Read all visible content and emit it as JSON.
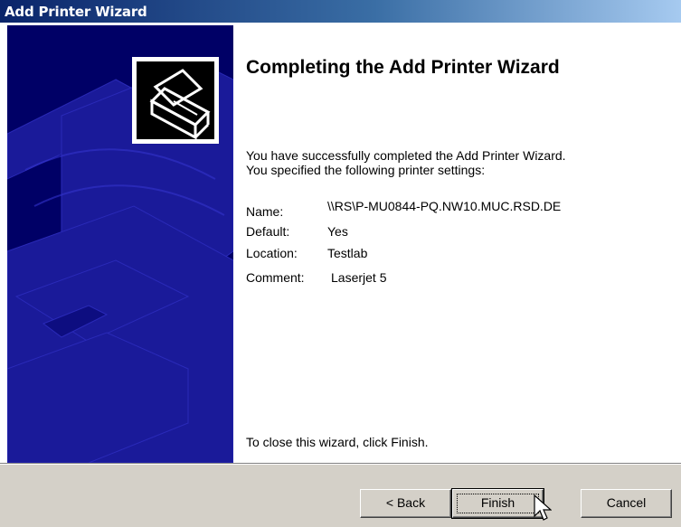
{
  "window": {
    "title": "Add Printer Wizard"
  },
  "content": {
    "heading": "Completing the Add Printer Wizard",
    "intro_line1": "You have successfully completed the Add Printer Wizard.",
    "intro_line2": "You specified the following printer settings:",
    "settings": [
      {
        "label": "Name:",
        "value": "\\\\RS\\P-MU0844-PQ.NW10.MUC.RSD.DE"
      },
      {
        "label": "Default:",
        "value": "Yes"
      },
      {
        "label": "Location:",
        "value": "Testlab"
      },
      {
        "label": "Comment:",
        "value": "Laserjet 5"
      }
    ],
    "close_hint": "To close this wizard, click Finish."
  },
  "buttons": {
    "back": "< Back",
    "finish": "Finish",
    "cancel": "Cancel"
  },
  "colors": {
    "banner": "#000066",
    "banner_art": "#1a1a99",
    "face": "#d4d0c8"
  },
  "icons": {
    "printer": "printer-icon",
    "cursor": "mouse-pointer-icon"
  }
}
